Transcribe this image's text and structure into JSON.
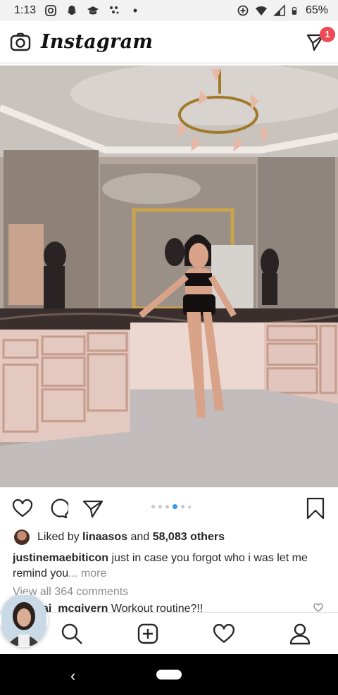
{
  "status_bar": {
    "time": "1:13",
    "battery": "65%",
    "icons_left": [
      "instagram-icon",
      "snapchat-icon",
      "graduation-cap-icon",
      "dots-app-icon",
      "dot-icon"
    ],
    "icons_right": [
      "data-saver-icon",
      "wifi-icon",
      "signal-icon",
      "battery-icon"
    ]
  },
  "header": {
    "logo": "Instagram",
    "camera_icon": "camera-icon",
    "dm_icon": "direct-message-icon",
    "dm_badge": "1"
  },
  "post": {
    "carousel": {
      "total": 6,
      "active_index": 3
    },
    "likes": {
      "prefix": "Liked by",
      "user": "linaasos",
      "conjunction": "and",
      "others": "58,083 others"
    },
    "caption": {
      "username": "justinemaebiticon",
      "text": "just in case you forgot who i was let me remind you",
      "more": "... more"
    },
    "view_all_comments": "View all 364 comments",
    "comments": [
      {
        "username": "ai_mcgivern",
        "text": "Workout routine?!!"
      }
    ]
  },
  "bottom_nav": {
    "items": [
      "home-icon",
      "search-icon",
      "new-post-icon",
      "activity-heart-icon",
      "profile-icon"
    ]
  },
  "colors": {
    "badge": "#ed4956",
    "carousel_active": "#3897f0",
    "muted_text": "#8e8e8e"
  }
}
